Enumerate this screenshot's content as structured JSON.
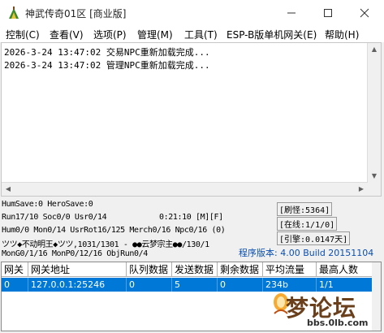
{
  "window": {
    "title": "神武传奇01区 [商业版]",
    "controls": [
      "minimize-icon",
      "maximize-icon",
      "close-icon"
    ]
  },
  "menu": [
    "控制(C)",
    "查看(V)",
    "选项(P)",
    "管理(M)",
    "工具(T)",
    "ESP-B版单机网关(E)",
    "帮助(H)"
  ],
  "log": [
    "2026-3-24 13:47:02 交易NPC重新加载完成...",
    "2026-3-24 13:47:02 管理NPC重新加载完成..."
  ],
  "status": {
    "line1": "HumSave:0 HeroSave:0",
    "line2": "Run17/10 Soc0/0 Usr0/14",
    "time": "0:21:10 [M][F]",
    "line3": "Hum0/0 Mon0/14 UsrRot16/125 Merch0/16 Npc0/16 (0)",
    "line4": "ツツ◆不动明王◆ツツ,1031/1301 - ●●云梦宗主●●/130/1",
    "line5": "MonG0/1/16 MonP0/12/16 ObjRun0/4",
    "refresh": "[刷怪:5364]",
    "online": "[在线:1/1/0]",
    "engine": "[引擎:0.0147天]",
    "version": "程序版本: 4.00 Build 20151104"
  },
  "table": {
    "columns": [
      "网关",
      "网关地址",
      "队列数据",
      "发送数据",
      "剩余数据",
      "平均流量",
      "最高人数"
    ],
    "rows": [
      [
        "0",
        "127.0.0.1:25246",
        "0",
        "5",
        "0",
        "234b",
        "1/1"
      ]
    ]
  },
  "watermark": {
    "text": "梦论坛",
    "url": "bbs.0lb.com"
  },
  "colors": {
    "selection": "#0078d7",
    "version_text": "#0a4fb0",
    "background": "#f0f0f0"
  }
}
